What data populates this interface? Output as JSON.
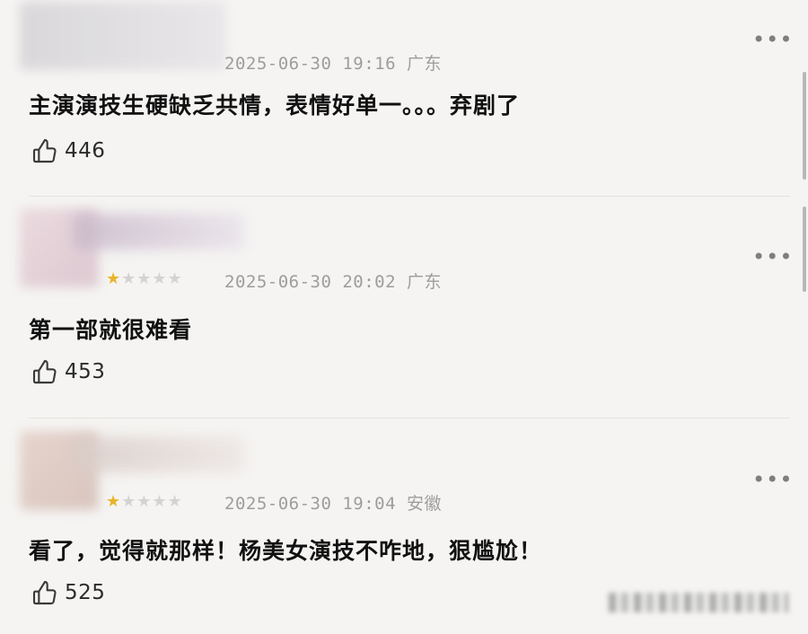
{
  "comments": [
    {
      "stars": "",
      "meta": "2025-06-30 19:16 广东",
      "text": "主演演技生硬缺乏共情，表情好单一。。。弃剧了",
      "likes": "446"
    },
    {
      "stars": "★★★★★",
      "meta": "2025-06-30 20:02 广东",
      "text": "第一部就很难看",
      "likes": "453"
    },
    {
      "stars": "★★★★★",
      "meta": "2025-06-30 19:04 安徽",
      "text": "看了，觉得就那样！杨美女演技不咋地，狠尴尬！",
      "likes": "525"
    }
  ],
  "more_glyph": "•••",
  "icons": {
    "like": "thumbs-up-icon",
    "more": "more-dots-icon"
  },
  "colors": {
    "background": "#f5f4f2",
    "meta": "#9d9d9d",
    "star_on": "#e8b42b"
  }
}
